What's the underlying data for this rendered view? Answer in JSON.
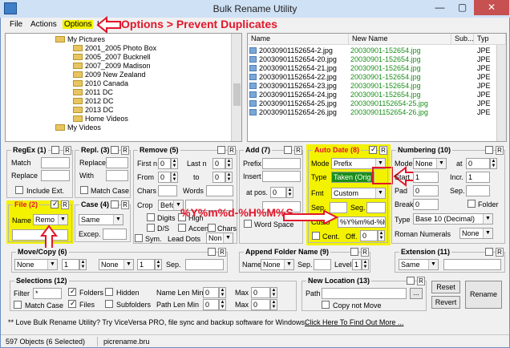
{
  "window": {
    "title": "Bulk Rename Utility",
    "minimize": "—",
    "maximize": "▢",
    "close": "✕"
  },
  "menu": [
    "File",
    "Actions",
    "Options",
    "Help"
  ],
  "annotation": {
    "main": "Options > Prevent Duplicates",
    "date_format": "%Y%m%d-%H%M%S"
  },
  "tree": [
    "My Pictures",
    "2001_2005 Photo Box",
    "2005_2007 Bucknell",
    "2007_2009 Madison",
    "2009 New Zealand",
    "2010 Canada",
    "2011 DC",
    "2012 DC",
    "2013 DC",
    "Home Videos",
    "My Videos"
  ],
  "file_columns": [
    "Name",
    "New Name",
    "Sub...",
    "Typ"
  ],
  "files": [
    {
      "name": "20030901152654-2.jpg",
      "new": "20030901-152654.jpg",
      "type": "JPE"
    },
    {
      "name": "20030901152654-20.jpg",
      "new": "20030901-152654.jpg",
      "type": "JPE"
    },
    {
      "name": "20030901152654-21.jpg",
      "new": "20030901-152654.jpg",
      "type": "JPE"
    },
    {
      "name": "20030901152654-22.jpg",
      "new": "20030901-152654.jpg",
      "type": "JPE"
    },
    {
      "name": "20030901152654-23.jpg",
      "new": "20030901-152654.jpg",
      "type": "JPE"
    },
    {
      "name": "20030901152654-24.jpg",
      "new": "20030901-152654.jpg",
      "type": "JPE"
    },
    {
      "name": "20030901152654-25.jpg",
      "new": "20030901152654-25.jpg",
      "type": "JPE"
    },
    {
      "name": "20030901152654-26.jpg",
      "new": "20030901152654-26.jpg",
      "type": "JPE"
    }
  ],
  "groups": {
    "regex": {
      "title": "RegEx (1)",
      "match": "Match",
      "replace": "Replace",
      "include_ext": "Include Ext."
    },
    "repl": {
      "title": "Repl. (3)",
      "replace": "Replace",
      "with": "With",
      "match_case": "Match Case"
    },
    "remove": {
      "title": "Remove (5)",
      "first_n": "First n",
      "first_val": "0",
      "last_n": "Last n",
      "last_val": "0",
      "from": "From",
      "from_val": "0",
      "to": "to",
      "to_val": "0",
      "chars": "Chars",
      "words": "Words",
      "crop": "Crop",
      "crop_val": "Befor",
      "digits": "Digits",
      "high": "High",
      "ds": "D/S",
      "accents": "Accents",
      "chars2": "Chars",
      "sym": "Sym.",
      "lead_dots": "Lead Dots",
      "non": "Non"
    },
    "add": {
      "title": "Add (7)",
      "prefix": "Prefix",
      "insert": "Insert",
      "at_pos": "at pos.",
      "at_pos_val": "0",
      "word_space": "Word Space"
    },
    "auto_date": {
      "title": "Auto Date (8)",
      "mode": "Mode",
      "mode_val": "Prefix",
      "type": "Type",
      "type_val": "Taken (Orig",
      "fmt": "Fmt",
      "fmt_val": "Custom",
      "sep": "Sep.",
      "seg": "Seg.",
      "custom": "Custo",
      "custom_val": "%Y%m%d-%H",
      "cent": "Cent.",
      "off": "Off.",
      "off_val": "0"
    },
    "numbering": {
      "title": "Numbering (10)",
      "mode": "Mode",
      "mode_val": "None",
      "at": "at",
      "at_val": "0",
      "start": "Start",
      "start_val": "1",
      "incr": "Incr.",
      "incr_val": "1",
      "pad": "Pad",
      "pad_val": "0",
      "sep": "Sep.",
      "break": "Break",
      "break_val": "0",
      "folder": "Folder",
      "type": "Type",
      "type_val": "Base 10 (Decimal)",
      "roman": "Roman Numerals",
      "roman_val": "None"
    },
    "file": {
      "title": "File (2)",
      "name": "Name",
      "name_val": "Remo"
    },
    "case": {
      "title": "Case (4)",
      "case_val": "Same",
      "excep": "Excep."
    },
    "move_copy": {
      "title": "Move/Copy (6)",
      "val1": "None",
      "num1": "1",
      "val2": "None",
      "num2": "1",
      "sep": "Sep."
    },
    "append": {
      "title": "Append Folder Name (9)",
      "name": "Name",
      "name_val": "None",
      "sep": "Sep.",
      "levels": "Levels",
      "levels_val": "1"
    },
    "extension": {
      "title": "Extension (11)",
      "val": "Same"
    },
    "selections": {
      "title": "Selections (12)",
      "filter": "Filter",
      "filter_val": "*",
      "folders": "Folders",
      "hidden": "Hidden",
      "name_len_min": "Name Len Min",
      "name_len_min_val": "0",
      "max": "Max",
      "max_val": "0",
      "match_case": "Match Case",
      "files": "Files",
      "subfolders": "Subfolders",
      "path_len_min": "Path Len Min",
      "path_len_min_val": "0",
      "max2": "Max",
      "max2_val": "0"
    },
    "new_location": {
      "title": "New Location (13)",
      "path": "Path",
      "browse": "...",
      "copy_not_move": "Copy not Move"
    }
  },
  "buttons": {
    "reset": "Reset",
    "revert": "Revert",
    "rename": "Rename"
  },
  "promo": {
    "text": "** Love Bulk Rename Utility? Try ViceVersa PRO, file sync and backup software for Windows.",
    "link": "Click Here To Find Out More ..."
  },
  "status": {
    "objects": "597 Objects (6 Selected)",
    "file": "picrename.bru"
  },
  "colors": {
    "accent": "#e2162a",
    "highlight": "#f3f200",
    "newname_green": "#1a8f1a"
  }
}
